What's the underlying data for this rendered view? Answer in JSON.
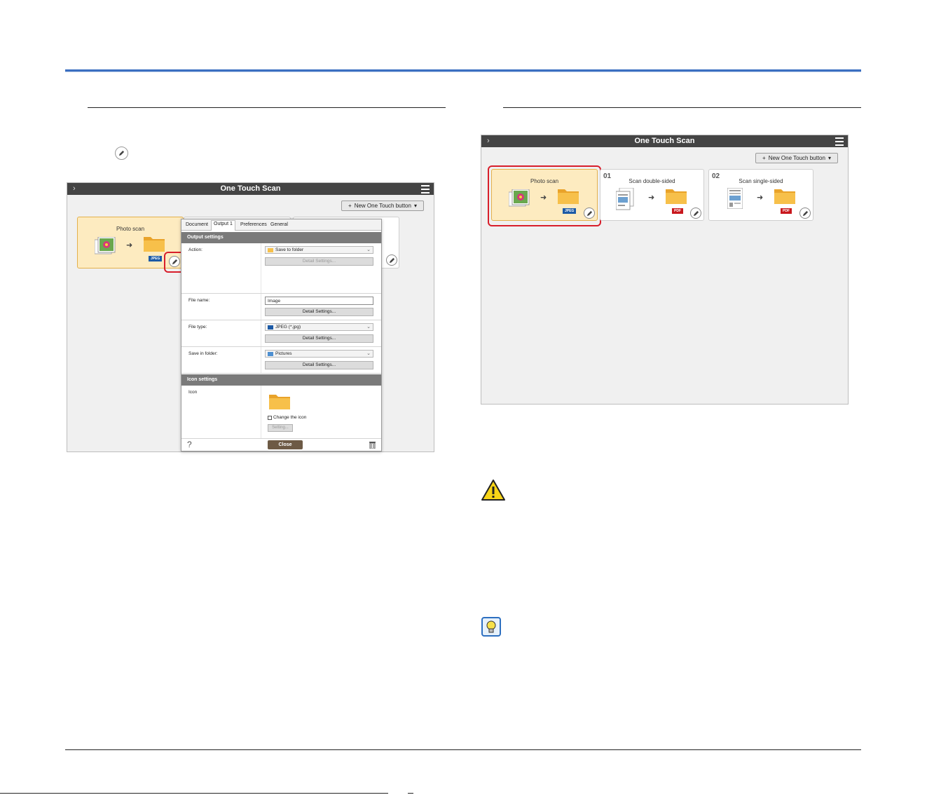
{
  "left_window": {
    "title": "One Touch Scan",
    "new_button_label": "New One Touch button",
    "card": {
      "title": "Photo scan",
      "badge": "JPEG"
    },
    "dialog": {
      "tabs": [
        "Document",
        "Output 1",
        "Preferences",
        "General"
      ],
      "output_section": "Output settings",
      "action_label": "Action:",
      "action_value": "Save to folder",
      "action_detail": "Detail Settings...",
      "filename_label": "File name:",
      "filename_value": "Image",
      "filename_detail": "Detail Settings...",
      "filetype_label": "File type:",
      "filetype_value": "JPEG (*.jpg)",
      "filetype_detail": "Detail Settings...",
      "folder_label": "Save in folder:",
      "folder_value": "Pictures",
      "folder_detail": "Detail Settings...",
      "icon_section": "Icon settings",
      "icon_label": "Icon",
      "change_icon_label": "Change the icon",
      "setting_button": "Setting...",
      "close_button": "Close",
      "help_glyph": "?"
    }
  },
  "right_window": {
    "title": "One Touch Scan",
    "new_button_label": "New One Touch button",
    "cards": [
      {
        "number": "",
        "title": "Photo scan",
        "badge": "JPEG"
      },
      {
        "number": "01",
        "title": "Scan double-sided",
        "badge": "PDF"
      },
      {
        "number": "02",
        "title": "Scan single-sided",
        "badge": "PDF"
      }
    ]
  },
  "colors": {
    "header_rule": "#3b6fc1",
    "titlebar": "#444444",
    "selected_card": "#fdebc0",
    "highlight_red": "#d81e2b",
    "jpeg_badge": "#1c5aa6",
    "pdf_badge": "#c8171d",
    "folder": "#f5b73b"
  },
  "icons": {
    "edit": "pencil-icon",
    "warning": "warning-triangle-icon",
    "hint": "lightbulb-hint-icon",
    "menu": "hamburger-menu-icon",
    "delete": "trash-icon"
  }
}
